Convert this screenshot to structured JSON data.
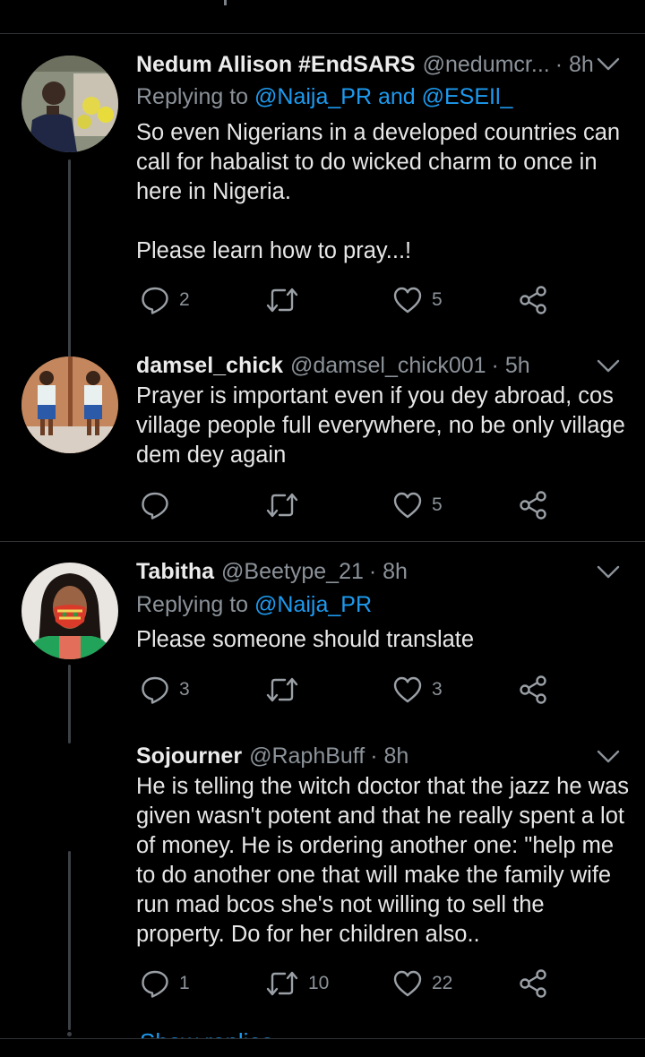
{
  "tweets": [
    {
      "name": "Nedum Allison #EndSARS",
      "handle": "@nedumcr...",
      "time": "· 8h",
      "replying_prefix": "Replying to ",
      "replying_to": "@Naija_PR and @ESEIl_",
      "text": "So even Nigerians in a developed countries can call for habalist to do wicked charm to once in here in Nigeria.\n\nPlease learn how to pray...!",
      "replies": "2",
      "retweets": "",
      "likes": "5"
    },
    {
      "name": "damsel_chick",
      "handle": "@damsel_chick001",
      "time": "· 5h",
      "text": "Prayer is important even if you dey abroad, cos village people full everywhere, no be only village dem dey again",
      "replies": "",
      "retweets": "",
      "likes": "5"
    },
    {
      "name": "Tabitha",
      "handle": "@Beetype_21",
      "time": "· 8h",
      "replying_prefix": "Replying to ",
      "replying_to": "@Naija_PR",
      "text": "Please someone should translate",
      "replies": "3",
      "retweets": "",
      "likes": "3"
    },
    {
      "name": "Sojourner",
      "handle": "@RaphBuff",
      "time": "· 8h",
      "text": "He is telling the witch doctor that the jazz he was given wasn't potent and that he really spent a lot of money. He is ordering another one: \"help me to do another one that will make the family wife run mad bcos she's not willing to sell the property. Do for her children also..",
      "replies": "1",
      "retweets": "10",
      "likes": "22"
    }
  ],
  "show_replies": "Show replies",
  "colors": {
    "background": "#000000",
    "text": "#e7e7e7",
    "muted": "#8b9299",
    "link": "#1d9bf0",
    "divider": "#2f3336"
  }
}
